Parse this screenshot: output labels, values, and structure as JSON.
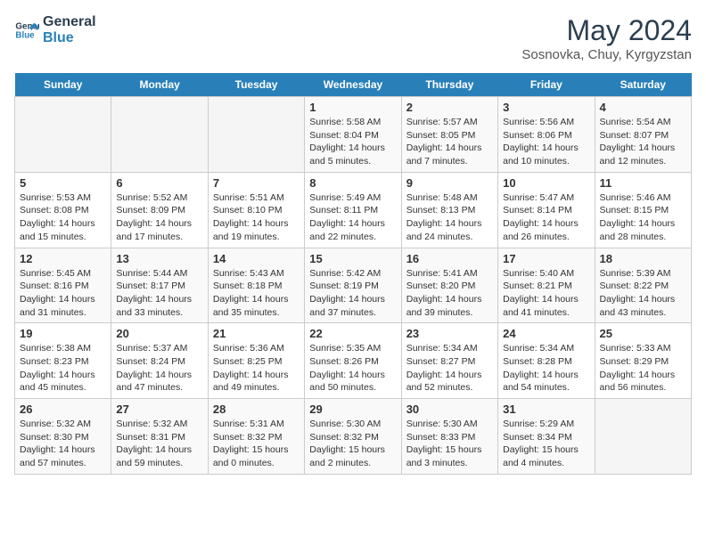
{
  "header": {
    "logo_line1": "General",
    "logo_line2": "Blue",
    "month_title": "May 2024",
    "location": "Sosnovka, Chuy, Kyrgyzstan"
  },
  "days_of_week": [
    "Sunday",
    "Monday",
    "Tuesday",
    "Wednesday",
    "Thursday",
    "Friday",
    "Saturday"
  ],
  "weeks": [
    [
      {
        "day": "",
        "info": ""
      },
      {
        "day": "",
        "info": ""
      },
      {
        "day": "",
        "info": ""
      },
      {
        "day": "1",
        "info": "Sunrise: 5:58 AM\nSunset: 8:04 PM\nDaylight: 14 hours\nand 5 minutes."
      },
      {
        "day": "2",
        "info": "Sunrise: 5:57 AM\nSunset: 8:05 PM\nDaylight: 14 hours\nand 7 minutes."
      },
      {
        "day": "3",
        "info": "Sunrise: 5:56 AM\nSunset: 8:06 PM\nDaylight: 14 hours\nand 10 minutes."
      },
      {
        "day": "4",
        "info": "Sunrise: 5:54 AM\nSunset: 8:07 PM\nDaylight: 14 hours\nand 12 minutes."
      }
    ],
    [
      {
        "day": "5",
        "info": "Sunrise: 5:53 AM\nSunset: 8:08 PM\nDaylight: 14 hours\nand 15 minutes."
      },
      {
        "day": "6",
        "info": "Sunrise: 5:52 AM\nSunset: 8:09 PM\nDaylight: 14 hours\nand 17 minutes."
      },
      {
        "day": "7",
        "info": "Sunrise: 5:51 AM\nSunset: 8:10 PM\nDaylight: 14 hours\nand 19 minutes."
      },
      {
        "day": "8",
        "info": "Sunrise: 5:49 AM\nSunset: 8:11 PM\nDaylight: 14 hours\nand 22 minutes."
      },
      {
        "day": "9",
        "info": "Sunrise: 5:48 AM\nSunset: 8:13 PM\nDaylight: 14 hours\nand 24 minutes."
      },
      {
        "day": "10",
        "info": "Sunrise: 5:47 AM\nSunset: 8:14 PM\nDaylight: 14 hours\nand 26 minutes."
      },
      {
        "day": "11",
        "info": "Sunrise: 5:46 AM\nSunset: 8:15 PM\nDaylight: 14 hours\nand 28 minutes."
      }
    ],
    [
      {
        "day": "12",
        "info": "Sunrise: 5:45 AM\nSunset: 8:16 PM\nDaylight: 14 hours\nand 31 minutes."
      },
      {
        "day": "13",
        "info": "Sunrise: 5:44 AM\nSunset: 8:17 PM\nDaylight: 14 hours\nand 33 minutes."
      },
      {
        "day": "14",
        "info": "Sunrise: 5:43 AM\nSunset: 8:18 PM\nDaylight: 14 hours\nand 35 minutes."
      },
      {
        "day": "15",
        "info": "Sunrise: 5:42 AM\nSunset: 8:19 PM\nDaylight: 14 hours\nand 37 minutes."
      },
      {
        "day": "16",
        "info": "Sunrise: 5:41 AM\nSunset: 8:20 PM\nDaylight: 14 hours\nand 39 minutes."
      },
      {
        "day": "17",
        "info": "Sunrise: 5:40 AM\nSunset: 8:21 PM\nDaylight: 14 hours\nand 41 minutes."
      },
      {
        "day": "18",
        "info": "Sunrise: 5:39 AM\nSunset: 8:22 PM\nDaylight: 14 hours\nand 43 minutes."
      }
    ],
    [
      {
        "day": "19",
        "info": "Sunrise: 5:38 AM\nSunset: 8:23 PM\nDaylight: 14 hours\nand 45 minutes."
      },
      {
        "day": "20",
        "info": "Sunrise: 5:37 AM\nSunset: 8:24 PM\nDaylight: 14 hours\nand 47 minutes."
      },
      {
        "day": "21",
        "info": "Sunrise: 5:36 AM\nSunset: 8:25 PM\nDaylight: 14 hours\nand 49 minutes."
      },
      {
        "day": "22",
        "info": "Sunrise: 5:35 AM\nSunset: 8:26 PM\nDaylight: 14 hours\nand 50 minutes."
      },
      {
        "day": "23",
        "info": "Sunrise: 5:34 AM\nSunset: 8:27 PM\nDaylight: 14 hours\nand 52 minutes."
      },
      {
        "day": "24",
        "info": "Sunrise: 5:34 AM\nSunset: 8:28 PM\nDaylight: 14 hours\nand 54 minutes."
      },
      {
        "day": "25",
        "info": "Sunrise: 5:33 AM\nSunset: 8:29 PM\nDaylight: 14 hours\nand 56 minutes."
      }
    ],
    [
      {
        "day": "26",
        "info": "Sunrise: 5:32 AM\nSunset: 8:30 PM\nDaylight: 14 hours\nand 57 minutes."
      },
      {
        "day": "27",
        "info": "Sunrise: 5:32 AM\nSunset: 8:31 PM\nDaylight: 14 hours\nand 59 minutes."
      },
      {
        "day": "28",
        "info": "Sunrise: 5:31 AM\nSunset: 8:32 PM\nDaylight: 15 hours\nand 0 minutes."
      },
      {
        "day": "29",
        "info": "Sunrise: 5:30 AM\nSunset: 8:32 PM\nDaylight: 15 hours\nand 2 minutes."
      },
      {
        "day": "30",
        "info": "Sunrise: 5:30 AM\nSunset: 8:33 PM\nDaylight: 15 hours\nand 3 minutes."
      },
      {
        "day": "31",
        "info": "Sunrise: 5:29 AM\nSunset: 8:34 PM\nDaylight: 15 hours\nand 4 minutes."
      },
      {
        "day": "",
        "info": ""
      }
    ]
  ]
}
